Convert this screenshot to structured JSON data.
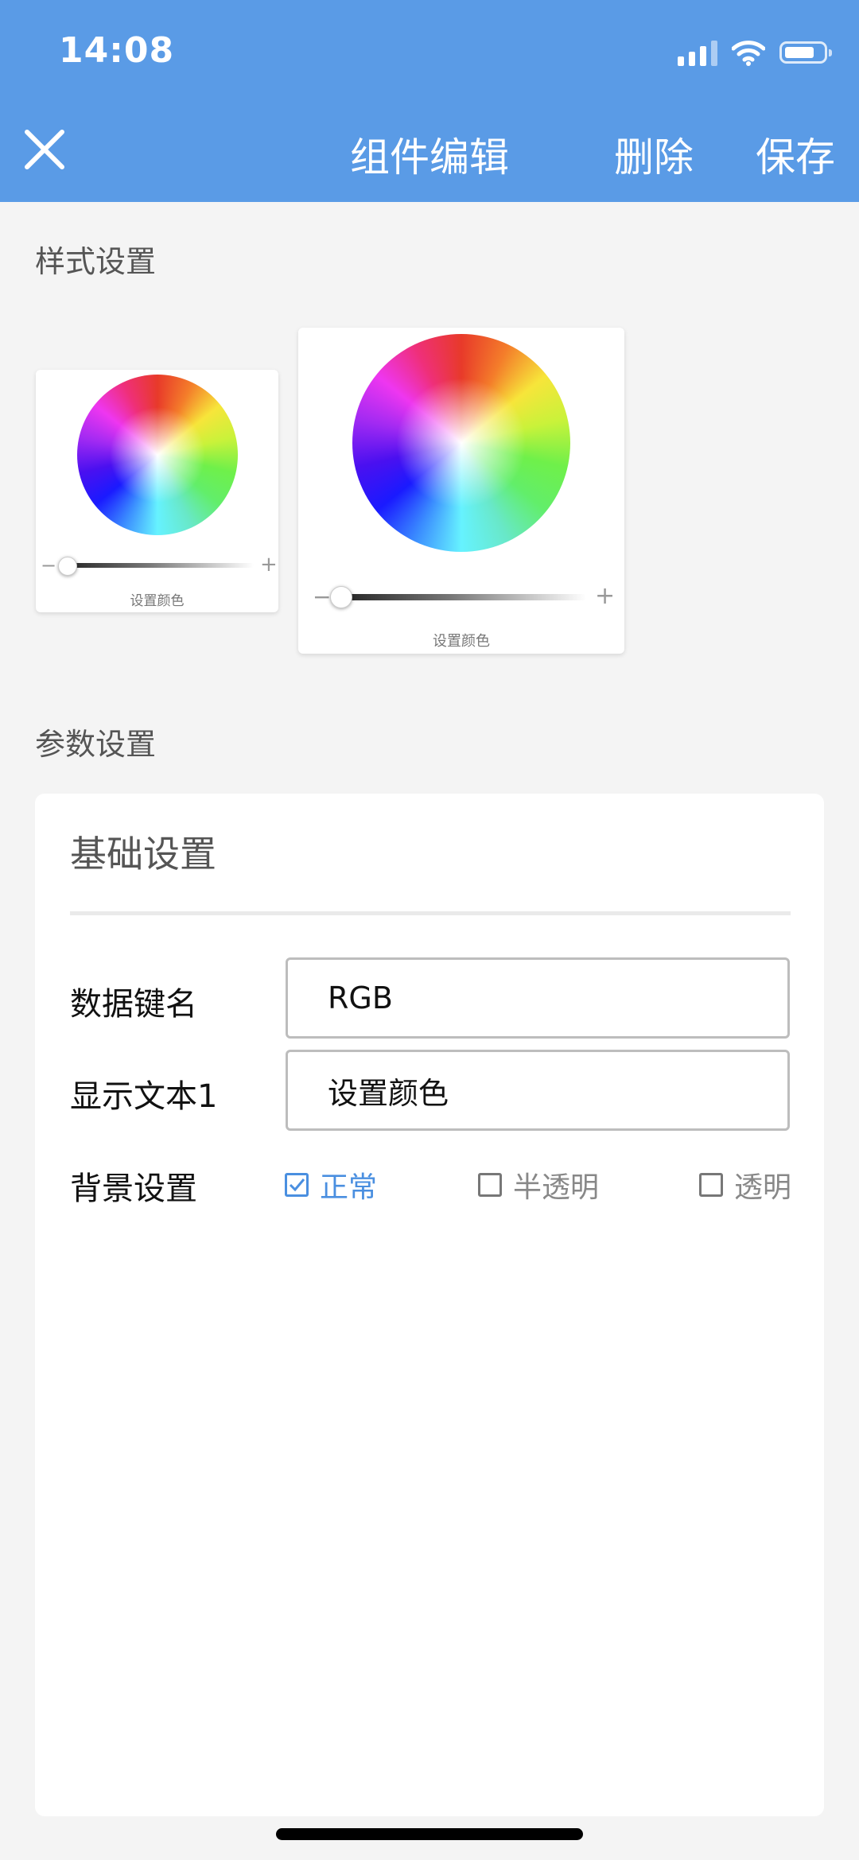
{
  "status_bar": {
    "time": "14:08"
  },
  "nav": {
    "title": "组件编辑",
    "delete_label": "删除",
    "save_label": "保存"
  },
  "style_section": {
    "title": "样式设置",
    "widgets": [
      {
        "label": "设置颜色",
        "slider_minus": "−",
        "slider_plus": "+"
      },
      {
        "label": "设置颜色",
        "slider_minus": "−",
        "slider_plus": "+"
      }
    ]
  },
  "params_section": {
    "title": "参数设置",
    "panel": {
      "heading": "基础设置",
      "data_key": {
        "label": "数据键名",
        "value": "RGB"
      },
      "display_text": {
        "label": "显示文本1",
        "value": "设置颜色"
      },
      "background": {
        "label": "背景设置",
        "options": [
          {
            "label": "正常",
            "checked": true
          },
          {
            "label": "半透明",
            "checked": false
          },
          {
            "label": "透明",
            "checked": false
          }
        ]
      }
    }
  },
  "colors": {
    "header": "#5a9be6",
    "accent": "#4a8fe0",
    "page_bg": "#f4f4f4"
  }
}
